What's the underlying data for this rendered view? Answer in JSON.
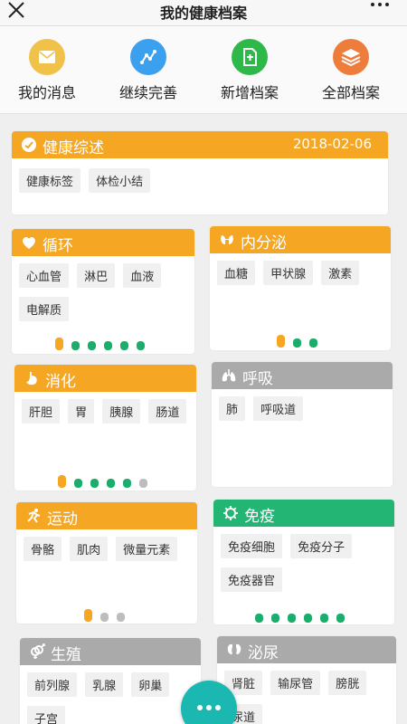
{
  "header": {
    "title": "我的健康档案",
    "close_icon": "close-icon",
    "more_icon": "more-icon"
  },
  "quick_actions": [
    {
      "label": "我的消息",
      "icon": "mail-icon",
      "color": "#f0c24a"
    },
    {
      "label": "继续完善",
      "icon": "chart-line-icon",
      "color": "#3ba0ee"
    },
    {
      "label": "新增档案",
      "icon": "add-document-icon",
      "color": "#2fb84a"
    },
    {
      "label": "全部档案",
      "icon": "layers-icon",
      "color": "#ee7d3c"
    }
  ],
  "summary": {
    "title": "健康综述",
    "date": "2018-02-06",
    "icon": "health-icon",
    "color": "#f5a623",
    "tags": [
      "健康标签",
      "体检小结"
    ]
  },
  "categories": [
    {
      "title": "循环",
      "icon": "heart-icon",
      "color": "#f5a623",
      "tags": [
        "心血管",
        "淋巴",
        "血液",
        "电解质"
      ],
      "levels": [
        {
          "color": "#f5a623",
          "h": 14
        },
        {
          "color": "#1aad6b",
          "h": 10
        },
        {
          "color": "#1aad6b",
          "h": 10
        },
        {
          "color": "#1aad6b",
          "h": 10
        },
        {
          "color": "#1aad6b",
          "h": 10
        },
        {
          "color": "#1aad6b",
          "h": 10
        }
      ]
    },
    {
      "title": "内分泌",
      "icon": "thyroid-icon",
      "color": "#f5a623",
      "tags": [
        "血糖",
        "甲状腺",
        "激素"
      ],
      "levels": [
        {
          "color": "#f5a623",
          "h": 14
        },
        {
          "color": "#1aad6b",
          "h": 10
        },
        {
          "color": "#1aad6b",
          "h": 10
        }
      ]
    },
    {
      "title": "消化",
      "icon": "stomach-icon",
      "color": "#f5a623",
      "tags": [
        "肝胆",
        "胃",
        "胰腺",
        "肠道"
      ],
      "levels": [
        {
          "color": "#f5a623",
          "h": 14
        },
        {
          "color": "#1aad6b",
          "h": 10
        },
        {
          "color": "#1aad6b",
          "h": 10
        },
        {
          "color": "#1aad6b",
          "h": 10
        },
        {
          "color": "#1aad6b",
          "h": 10
        },
        {
          "color": "#bdbdbd",
          "h": 10
        }
      ]
    },
    {
      "title": "呼吸",
      "icon": "lungs-icon",
      "color": "#aaaaaa",
      "tags": [
        "肺",
        "呼吸道"
      ],
      "levels": []
    },
    {
      "title": "运动",
      "icon": "running-icon",
      "color": "#f5a623",
      "tags": [
        "骨骼",
        "肌肉",
        "微量元素"
      ],
      "levels": [
        {
          "color": "#f5a623",
          "h": 14
        },
        {
          "color": "#bdbdbd",
          "h": 10
        },
        {
          "color": "#bdbdbd",
          "h": 10
        }
      ]
    },
    {
      "title": "免疫",
      "icon": "virus-icon",
      "color": "#22b573",
      "tags": [
        "免疫细胞",
        "免疫分子",
        "免疫器官"
      ],
      "levels": [
        {
          "color": "#1aad6b",
          "h": 10
        },
        {
          "color": "#1aad6b",
          "h": 10
        },
        {
          "color": "#1aad6b",
          "h": 10
        },
        {
          "color": "#1aad6b",
          "h": 10
        },
        {
          "color": "#1aad6b",
          "h": 10
        },
        {
          "color": "#1aad6b",
          "h": 10
        }
      ]
    },
    {
      "title": "生殖",
      "icon": "gender-icon",
      "color": "#aaaaaa",
      "tags": [
        "前列腺",
        "乳腺",
        "卵巢",
        "子宫"
      ],
      "levels": []
    },
    {
      "title": "泌尿",
      "icon": "kidney-icon",
      "color": "#aaaaaa",
      "tags": [
        "肾脏",
        "输尿管",
        "膀胱",
        "尿道"
      ],
      "levels": []
    }
  ],
  "fab": {
    "icon": "chat-icon",
    "color": "#1bb8b1"
  }
}
